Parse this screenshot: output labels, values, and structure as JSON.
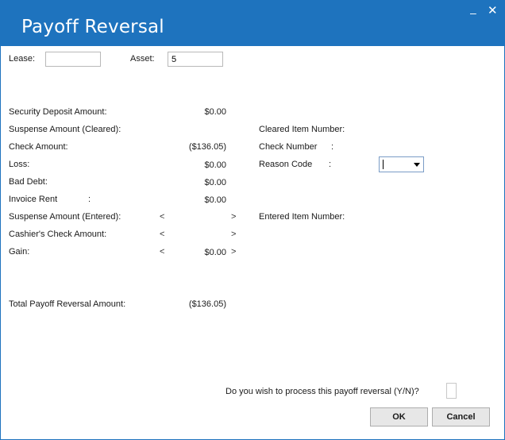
{
  "window": {
    "title": "Payoff Reversal",
    "minimize_glyph": "–",
    "close_glyph": "✕"
  },
  "lease": {
    "label": "Lease:",
    "value": ""
  },
  "asset": {
    "label": "Asset:",
    "value": "5"
  },
  "left": {
    "security_deposit": {
      "label": "Security Deposit Amount:",
      "value": "$0.00"
    },
    "suspense_cleared": {
      "label": "Suspense Amount (Cleared):",
      "value": ""
    },
    "check_amount": {
      "label": "Check Amount:",
      "value": "($136.05)"
    },
    "loss": {
      "label": "Loss:",
      "value": "$0.00"
    },
    "bad_debt": {
      "label": "Bad Debt:",
      "value": "$0.00"
    },
    "invoice_rent": {
      "label": "Invoice Rent",
      "colon": ":",
      "value": "$0.00"
    },
    "suspense_entered": {
      "label": "Suspense Amount (Entered):",
      "prev": "<",
      "value": "",
      "next": ">"
    },
    "cashiers_check": {
      "label": "Cashier's Check Amount:",
      "prev": "<",
      "value": "",
      "next": ">"
    },
    "gain": {
      "label": "Gain:",
      "prev": "<",
      "value": "$0.00",
      "next": ">"
    },
    "total": {
      "label": "Total Payoff Reversal Amount:",
      "value": "($136.05)"
    }
  },
  "right": {
    "cleared_item": {
      "label": "Cleared Item Number:"
    },
    "check_number": {
      "label": "Check Number",
      "colon": ":"
    },
    "reason_code": {
      "label": "Reason Code",
      "colon": ":",
      "value": ""
    },
    "entered_item": {
      "label": "Entered Item Number:"
    }
  },
  "confirm": {
    "question": "Do you wish to process this payoff reversal (Y/N)?",
    "value": ""
  },
  "buttons": {
    "ok": "OK",
    "cancel": "Cancel"
  }
}
